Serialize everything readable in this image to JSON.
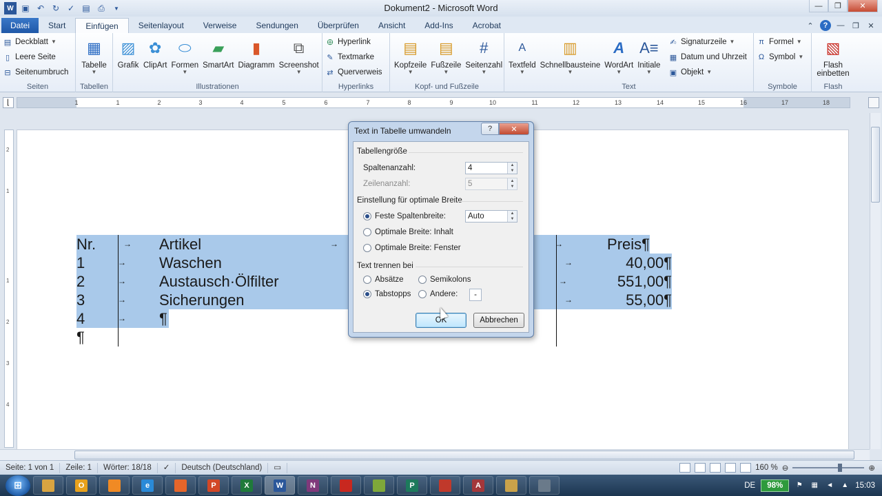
{
  "window": {
    "title": "Dokument2 - Microsoft Word"
  },
  "qat": {
    "icons": [
      "word-icon",
      "save-icon",
      "undo-icon",
      "redo-icon",
      "spellcheck-icon",
      "print-preview-icon",
      "print-icon"
    ]
  },
  "tabs": [
    {
      "label": "Datei",
      "key": "file"
    },
    {
      "label": "Start",
      "key": "start"
    },
    {
      "label": "Einfügen",
      "key": "insert",
      "active": true
    },
    {
      "label": "Seitenlayout",
      "key": "layout"
    },
    {
      "label": "Verweise",
      "key": "references"
    },
    {
      "label": "Sendungen",
      "key": "mailings"
    },
    {
      "label": "Überprüfen",
      "key": "review"
    },
    {
      "label": "Ansicht",
      "key": "view"
    },
    {
      "label": "Add-Ins",
      "key": "addins"
    },
    {
      "label": "Acrobat",
      "key": "acrobat"
    }
  ],
  "ribbon": {
    "seiten": {
      "label": "Seiten",
      "items": [
        "Deckblatt",
        "Leere Seite",
        "Seitenumbruch"
      ]
    },
    "tabellen": {
      "label": "Tabellen",
      "tabelle": "Tabelle"
    },
    "illustrationen": {
      "label": "Illustrationen",
      "items": [
        "Grafik",
        "ClipArt",
        "Formen",
        "SmartArt",
        "Diagramm",
        "Screenshot"
      ]
    },
    "hyperlinks": {
      "label": "Hyperlinks",
      "items": [
        "Hyperlink",
        "Textmarke",
        "Querverweis"
      ]
    },
    "kopf": {
      "label": "Kopf- und Fußzeile",
      "items": [
        "Kopfzeile",
        "Fußzeile",
        "Seitenzahl"
      ]
    },
    "text": {
      "label": "Text",
      "items": [
        "Textfeld",
        "Schnellbausteine",
        "WordArt",
        "Initiale"
      ],
      "small": [
        "Signaturzeile",
        "Datum und Uhrzeit",
        "Objekt"
      ]
    },
    "symbole": {
      "label": "Symbole",
      "items": [
        "Formel",
        "Symbol"
      ]
    },
    "flash": {
      "label": "Flash",
      "line1": "Flash",
      "line2": "einbetten"
    }
  },
  "ruler": {
    "ticks": [
      "1",
      "1",
      "2",
      "3",
      "4",
      "5",
      "6",
      "7",
      "8",
      "9",
      "10",
      "11",
      "12",
      "13",
      "14",
      "15",
      "16",
      "17",
      "18"
    ]
  },
  "vruler": {
    "ticks": [
      "2",
      "1",
      "1",
      "2",
      "3",
      "4"
    ]
  },
  "document": {
    "rows": [
      {
        "nr": "Nr.",
        "artikel": "Artikel",
        "preis": "Preis¶"
      },
      {
        "nr": "1",
        "artikel": "Waschen",
        "preis": "40,00¶"
      },
      {
        "nr": "2",
        "artikel": "Austausch·Ölfilter",
        "preis": "551,00¶"
      },
      {
        "nr": "3",
        "artikel": "Sicherungen",
        "preis": "55,00¶"
      },
      {
        "nr": "4",
        "artikel": "¶",
        "preis": ""
      }
    ],
    "last_para": "¶",
    "tab_glyph": "→"
  },
  "dialog": {
    "title": "Text in Tabelle umwandeln",
    "help": "?",
    "close": "✕",
    "section_size": "Tabellengröße",
    "columns_label": "Spaltenanzahl:",
    "columns_value": "4",
    "rows_label": "Zeilenanzahl:",
    "rows_value": "5",
    "section_width": "Einstellung für optimale Breite",
    "fixed_width": "Feste Spaltenbreite:",
    "fixed_width_value": "Auto",
    "opt_content": "Optimale Breite: Inhalt",
    "opt_window": "Optimale Breite: Fenster",
    "section_separate": "Text trennen bei",
    "sep_paragraphs": "Absätze",
    "sep_semicolons": "Semikolons",
    "sep_tabs": "Tabstopps",
    "sep_other": "Andere:",
    "other_value": "-",
    "ok": "OK",
    "cancel": "Abbrechen"
  },
  "status": {
    "page": "Seite: 1 von 1",
    "line": "Zeile: 1",
    "words": "Wörter: 18/18",
    "language": "Deutsch (Deutschland)",
    "zoom": "160 %"
  },
  "taskbar": {
    "apps": [
      {
        "label": "",
        "icon": "explorer-icon",
        "color": "#d9a441"
      },
      {
        "label": "O",
        "icon": "outlook-icon",
        "color": "#e8a11c"
      },
      {
        "label": "",
        "icon": "media-player-icon",
        "color": "#f08a24"
      },
      {
        "label": "e",
        "icon": "ie-icon",
        "color": "#2a8ad8"
      },
      {
        "label": "",
        "icon": "firefox-icon",
        "color": "#e5652a"
      },
      {
        "label": "P",
        "icon": "powerpoint-icon",
        "color": "#d24726"
      },
      {
        "label": "X",
        "icon": "excel-icon",
        "color": "#1f7a3a"
      },
      {
        "label": "W",
        "icon": "word-icon",
        "color": "#2b579a",
        "active": true
      },
      {
        "label": "N",
        "icon": "onenote-icon",
        "color": "#80397b"
      },
      {
        "label": "",
        "icon": "acrobat-icon",
        "color": "#c8281f"
      },
      {
        "label": "",
        "icon": "project-icon",
        "color": "#7fa83a"
      },
      {
        "label": "P",
        "icon": "publisher-icon",
        "color": "#1d7a5c"
      },
      {
        "label": "",
        "icon": "tool-icon",
        "color": "#c0392b"
      },
      {
        "label": "A",
        "icon": "access-icon",
        "color": "#a4373a"
      },
      {
        "label": "",
        "icon": "folder-icon",
        "color": "#caa24a"
      },
      {
        "label": "",
        "icon": "settings-icon",
        "color": "#6a7a8a"
      }
    ],
    "language": "DE",
    "battery": "98%",
    "time": "15:03"
  }
}
